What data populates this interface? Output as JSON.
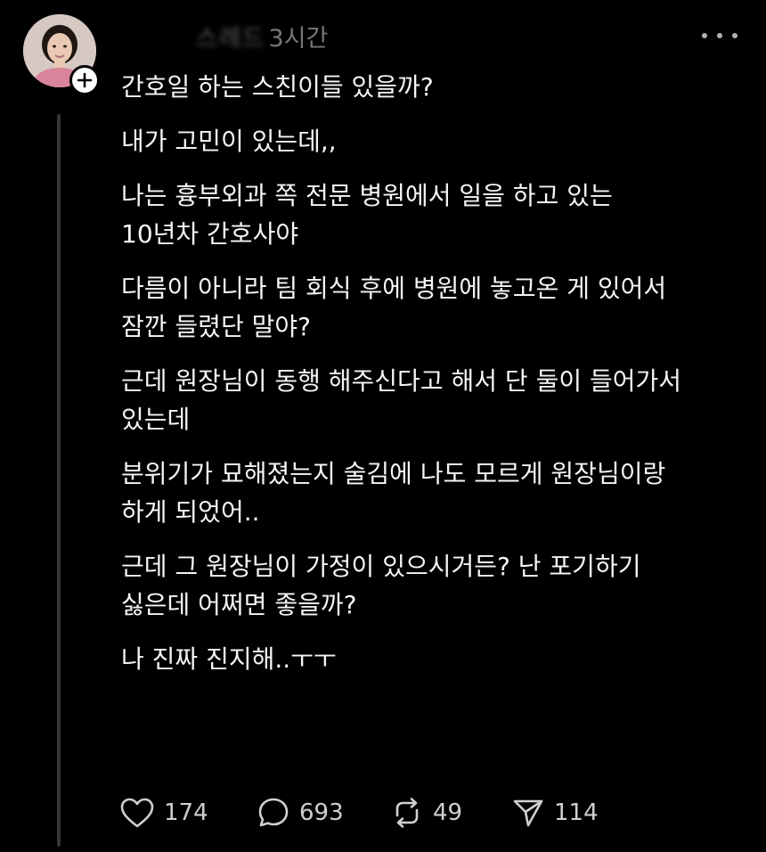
{
  "post": {
    "username": "스레드",
    "timestamp": "3시간",
    "paragraphs": [
      "간호일 하는 스친이들 있을까?",
      "내가 고민이 있는데,,",
      "나는 흉부외과 쪽 전문 병원에서 일을 하고 있는\n10년차 간호사야",
      "다름이 아니라 팀 회식 후에 병원에 놓고온 게 있어서\n잠깐 들렸단 말야?",
      "근데 원장님이 동행 해주신다고 해서 단 둘이 들어가서\n있는데",
      "분위기가 묘해졌는지 술김에 나도 모르게 원장님이랑\n하게 되었어..",
      "근데 그 원장님이 가정이 있으시거든? 난 포기하기\n싫은데 어쩌면 좋을까?",
      "나 진짜 진지해..ㅜㅜ"
    ],
    "stats": {
      "likes": "174",
      "comments": "693",
      "reposts": "49",
      "shares": "114"
    }
  },
  "icons": {
    "follow": "plus-icon",
    "more": "more-dots-icon",
    "like": "heart-icon",
    "comment": "comment-bubble-icon",
    "repost": "repost-icon",
    "share": "send-icon"
  },
  "colors": {
    "background": "#000000",
    "text": "#f3f5f7",
    "muted": "#777777",
    "thread_line": "#333638"
  }
}
